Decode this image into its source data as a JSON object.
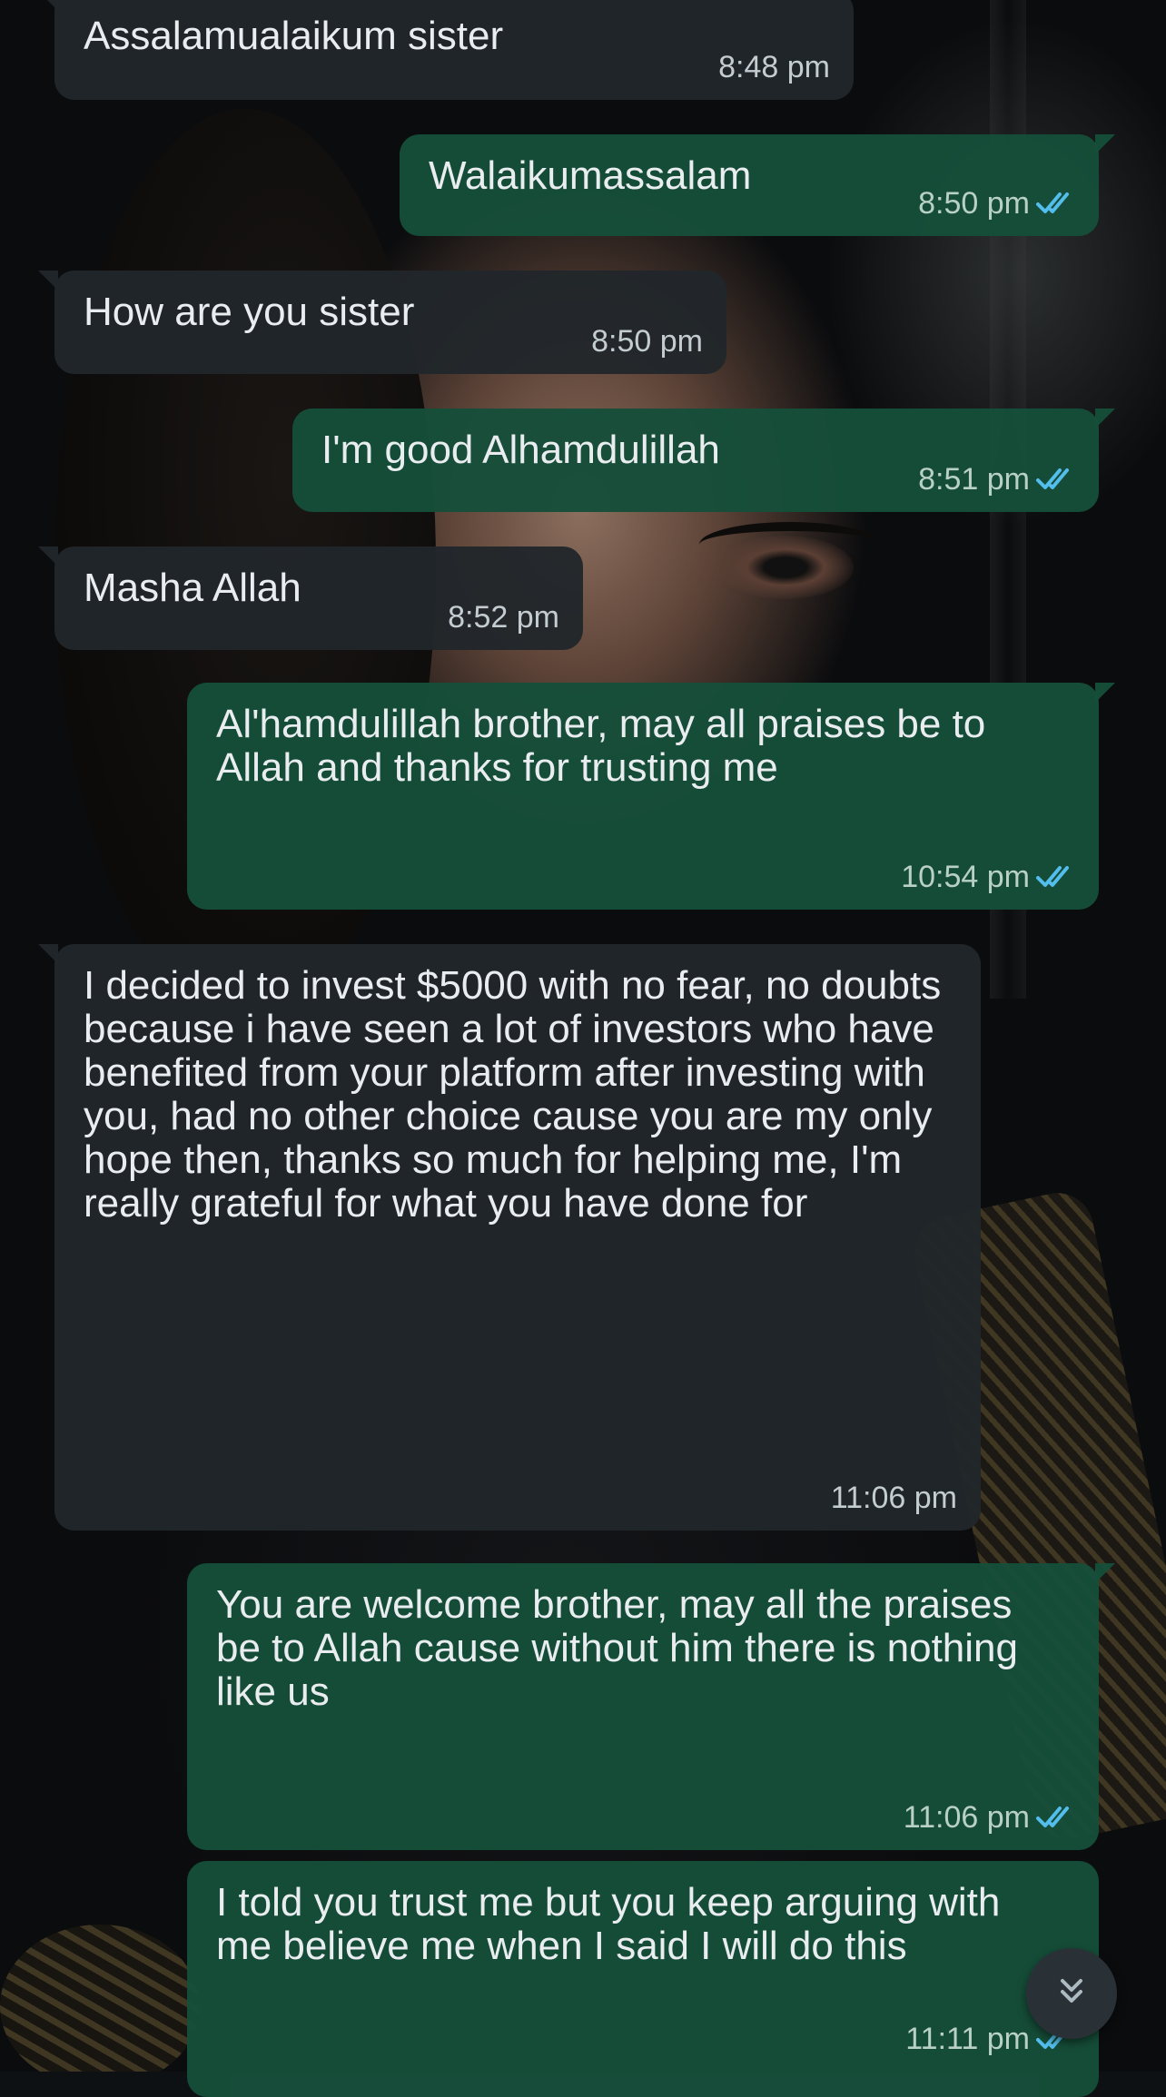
{
  "messages": [
    {
      "dir": "in",
      "text": "Assalamualaikum sister",
      "time": "8:48 pm"
    },
    {
      "dir": "out",
      "text": "Walaikumassalam",
      "time": "8:50 pm",
      "status": "read"
    },
    {
      "dir": "in",
      "text": "How are you sister",
      "time": "8:50 pm"
    },
    {
      "dir": "out",
      "text": "I'm good Alhamdulillah",
      "time": "8:51 pm",
      "status": "read"
    },
    {
      "dir": "in",
      "text": "Masha Allah",
      "time": "8:52 pm"
    },
    {
      "dir": "out",
      "text": "Al'hamdulillah brother, may all praises be to Allah and thanks for trusting me",
      "time": "10:54 pm",
      "status": "read"
    },
    {
      "dir": "in",
      "text": "I decided to invest $5000 with no fear, no doubts because i have seen a lot of investors who have benefited from your platform after investing with you, had no other choice cause you are my only hope then, thanks so much for helping me, I'm really grateful for what you have done for",
      "time": "11:06 pm"
    },
    {
      "dir": "out",
      "text": "You are welcome brother, may all the praises be to Allah cause without him there is nothing like us",
      "time": "11:06 pm",
      "status": "read"
    },
    {
      "dir": "out",
      "text": "I told you trust me but you keep arguing with me believe me when I said I will do this",
      "time": "11:11 pm",
      "status": "read"
    }
  ],
  "icons": {
    "read_receipt": "double-check-icon",
    "scroll_down": "chevrons-down-icon"
  },
  "colors": {
    "incoming_bubble": "#21262b",
    "outgoing_bubble": "#164e3a",
    "text": "#e9edef",
    "read_tick": "#53bdeb"
  }
}
